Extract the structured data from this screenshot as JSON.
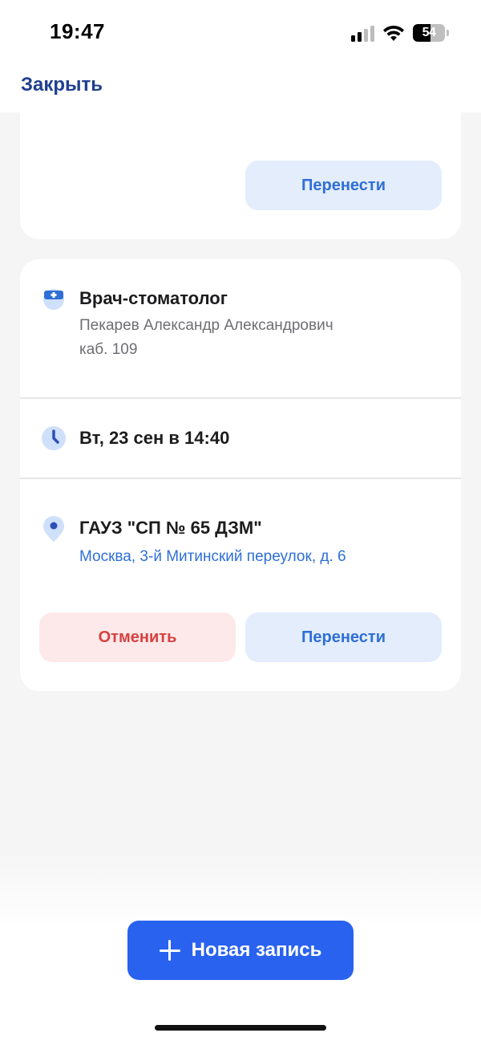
{
  "status_bar": {
    "time": "19:47",
    "battery": "54",
    "battery_level_percent": 54,
    "icons": [
      "cellular-signal-icon",
      "wifi-icon",
      "battery-icon"
    ]
  },
  "header": {
    "close_label": "Закрыть"
  },
  "appointments": [
    {
      "partial": true,
      "reschedule_label": "Перенести"
    },
    {
      "specialty": "Врач-стоматолог",
      "doctor": "Пекарев Александр Александрович",
      "room": "каб. 109",
      "datetime": "Вт, 23 сен в 14:40",
      "clinic": "ГАУЗ \"СП № 65 ДЗМ\"",
      "address": "Москва, 3-й Митинский переулок, д. 6",
      "cancel_label": "Отменить",
      "reschedule_label": "Перенести"
    }
  ],
  "fab": {
    "label": "Новая запись",
    "icon": "plus-icon"
  },
  "colors": {
    "accent": "#2a62f0",
    "link": "#2f6fd6",
    "danger": "#d64040",
    "header_link": "#1f3f8f"
  }
}
